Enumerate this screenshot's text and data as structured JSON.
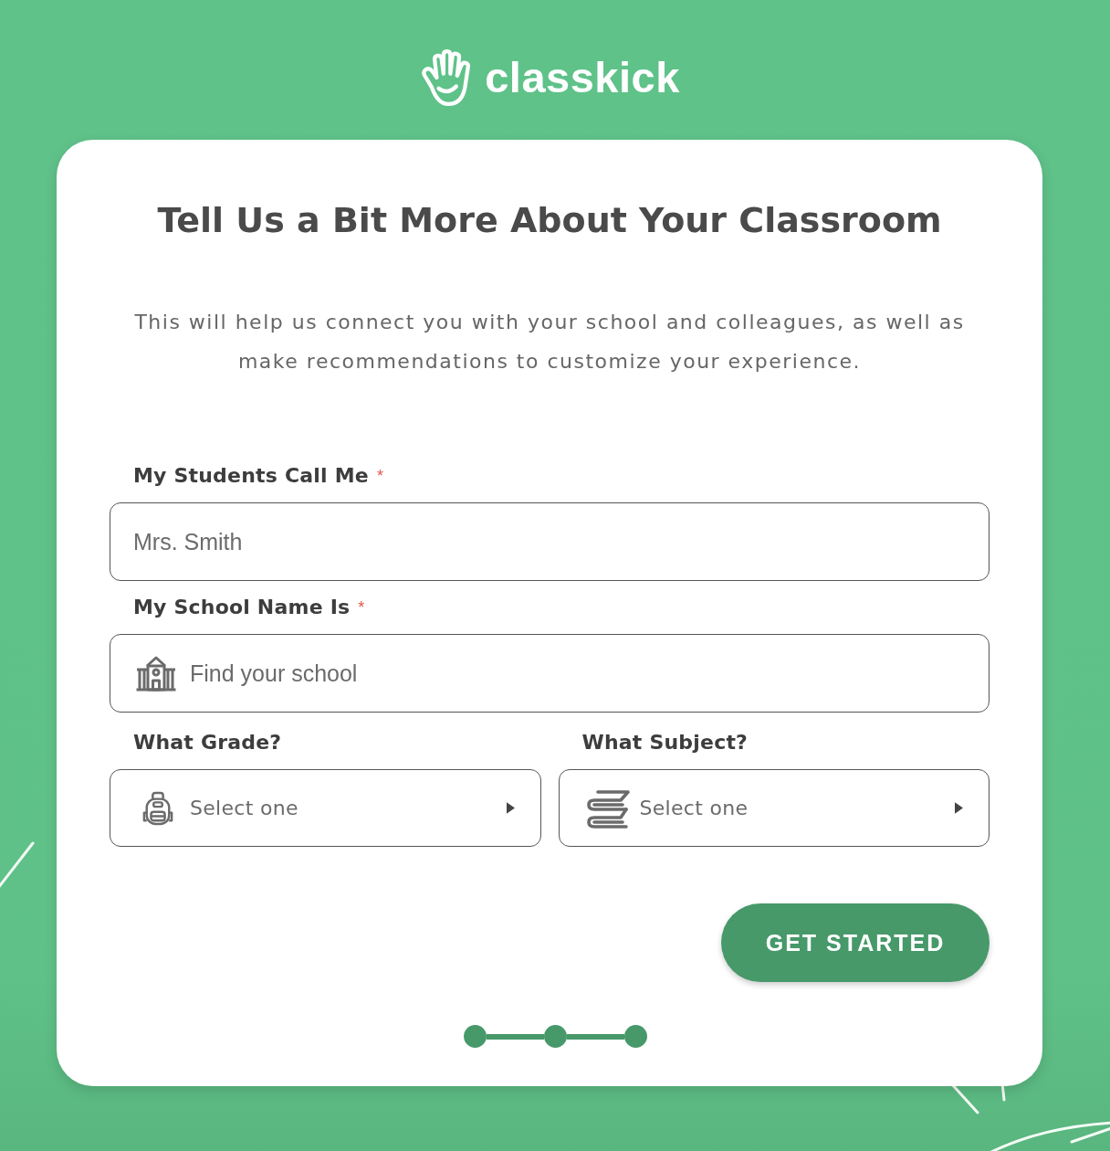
{
  "logo": {
    "wordmark": "classkick"
  },
  "card": {
    "title": "Tell Us a Bit More About Your Classroom",
    "subtitle": "This will help us connect you with your school and colleagues, as well as make recommendations to customize your experience.",
    "fields": [
      {
        "kind": "text",
        "label": "My Students Call Me",
        "required_mark": "*",
        "placeholder": "Mrs. Smith"
      },
      {
        "kind": "school-search",
        "label": "My School Name Is",
        "required_mark": "*",
        "placeholder": "Find your school"
      }
    ],
    "dropdowns": [
      {
        "label": "What Grade?",
        "placeholder": "Select one"
      },
      {
        "label": "What Subject?",
        "placeholder": "Select one"
      }
    ],
    "submit_button": "GET STARTED",
    "progress": {
      "steps": [
        {
          "completed": true
        },
        {
          "completed": true
        },
        {
          "completed": true
        }
      ]
    }
  }
}
